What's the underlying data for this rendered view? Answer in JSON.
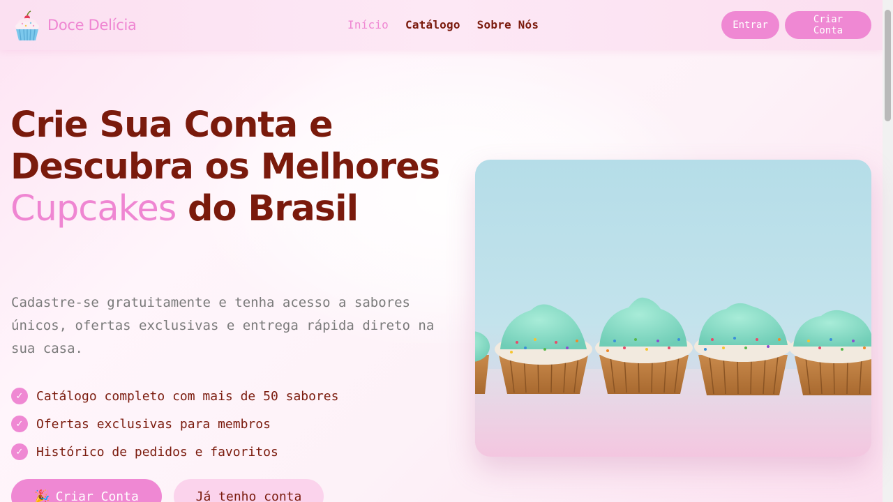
{
  "header": {
    "brand": "Doce Delícia",
    "logo_icon": "cupcake-icon",
    "nav": [
      {
        "label": "Início",
        "active": true
      },
      {
        "label": "Catálogo",
        "active": false
      },
      {
        "label": "Sobre Nós",
        "active": false
      }
    ],
    "login_label": "Entrar",
    "signup_label": "Criar Conta"
  },
  "hero": {
    "title_part1": "Crie Sua Conta e Descubra os Melhores ",
    "title_highlight": "Cupcakes",
    "title_part2": " do Brasil",
    "subtitle": "Cadastre-se gratuitamente e tenha acesso a sabores únicos, ofertas exclusivas e entrega rápida direto na sua casa.",
    "features": [
      "Catálogo completo com mais de 50 sabores",
      "Ofertas exclusivas para membros",
      "Histórico de pedidos e favoritos"
    ],
    "check_icon": "✓",
    "cta_primary_emoji": "🎉",
    "cta_primary_label": "Criar Conta",
    "cta_secondary_label": "Já tenho conta",
    "image_icon": "cupcakes-photo"
  },
  "colors": {
    "accent": "#ef88d3",
    "text_dark": "#7a1a0c",
    "text_muted": "#7a7a7a"
  }
}
